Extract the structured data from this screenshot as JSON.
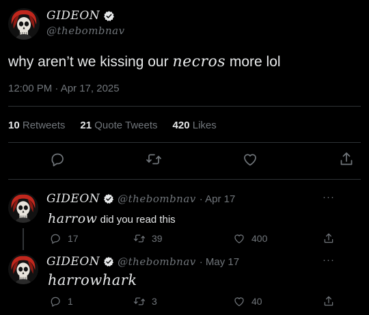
{
  "tweet": {
    "author_name": "GIDEON",
    "handle": "@thebombnav",
    "text_before": "why aren’t we kissing our",
    "text_styled": "necros",
    "text_after": "more lol",
    "timestamp": "12:00 PM · Apr 17, 2025",
    "stats": [
      {
        "count": "10",
        "label": "Retweets"
      },
      {
        "count": "21",
        "label": "Quote Tweets"
      },
      {
        "count": "420",
        "label": "Likes"
      }
    ]
  },
  "replies": [
    {
      "author_name": "GIDEON",
      "handle": "@thebombnav",
      "date": "· Apr 17",
      "more": "···",
      "text_styled": "harrow",
      "text": "did you read this",
      "replies": "17",
      "retweets": "39",
      "likes": "400"
    },
    {
      "author_name": "GIDEON",
      "handle": "@thebombnav",
      "date": "· May 17",
      "more": "···",
      "text_styled": "harrowhark",
      "text": "",
      "replies": "1",
      "retweets": "3",
      "likes": "40"
    }
  ],
  "icons": {
    "verified": "verified-badge-icon",
    "reply": "reply-icon",
    "retweet": "retweet-icon",
    "like": "heart-icon",
    "share": "share-icon",
    "avatar": "skull-avatar"
  },
  "colors": {
    "background": "#000000",
    "text": "#e7e9ea",
    "muted": "#71767b",
    "divider": "#2f3336",
    "avatar_red": "#c0271d"
  }
}
